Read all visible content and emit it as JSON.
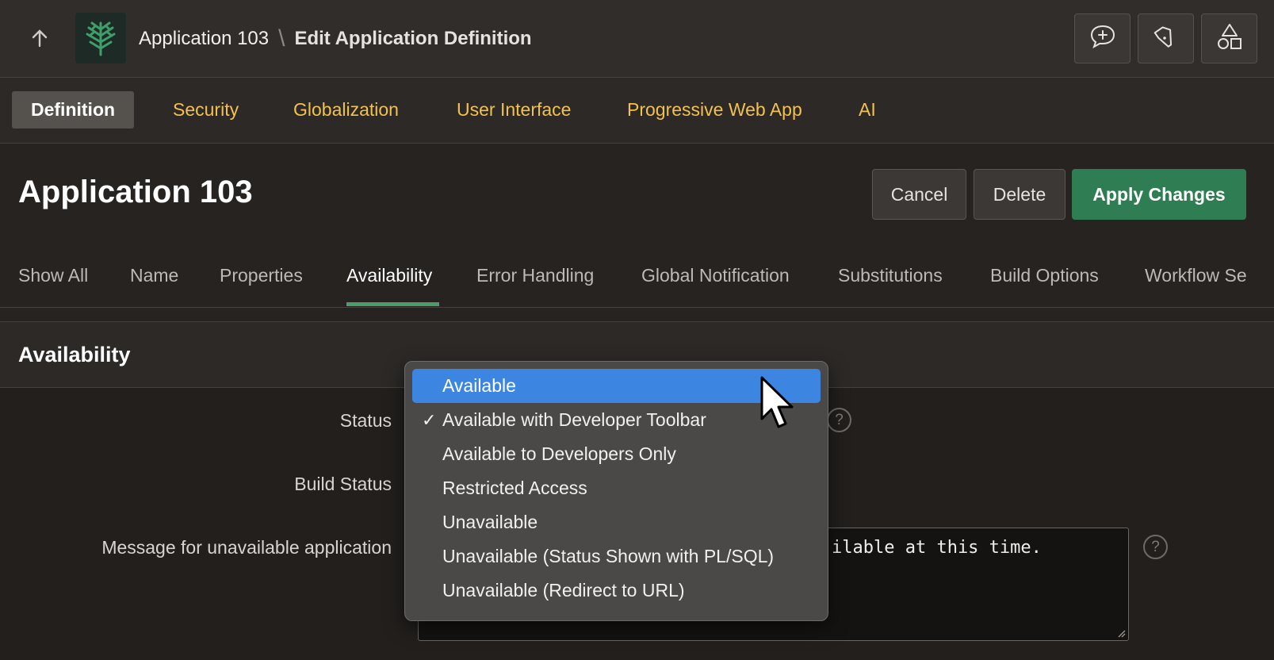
{
  "header": {
    "breadcrumb_app": "Application 103",
    "breadcrumb_separator": "\\",
    "breadcrumb_current": "Edit Application Definition",
    "icons": [
      "up-arrow-icon",
      "app-logo-icon",
      "feedback-icon",
      "flashlight-icon",
      "shapes-icon"
    ]
  },
  "tabs": [
    {
      "label": "Definition",
      "active": true
    },
    {
      "label": "Security"
    },
    {
      "label": "Globalization"
    },
    {
      "label": "User Interface"
    },
    {
      "label": "Progressive Web App"
    },
    {
      "label": "AI"
    }
  ],
  "page": {
    "title": "Application 103",
    "cancel_label": "Cancel",
    "delete_label": "Delete",
    "apply_label": "Apply Changes"
  },
  "sections": [
    {
      "label": "Show All"
    },
    {
      "label": "Name"
    },
    {
      "label": "Properties"
    },
    {
      "label": "Availability",
      "active": true
    },
    {
      "label": "Error Handling"
    },
    {
      "label": "Global Notification"
    },
    {
      "label": "Substitutions"
    },
    {
      "label": "Build Options"
    },
    {
      "label": "Workflow Se"
    }
  ],
  "region": {
    "title": "Availability",
    "status_label": "Status",
    "build_status_label": "Build Status",
    "message_label": "Message for unavailable application",
    "message_value_visible": "ilable at this time.",
    "help_symbol": "?"
  },
  "status_menu": {
    "options": [
      {
        "label": "Available",
        "highlighted": true
      },
      {
        "label": "Available with Developer Toolbar",
        "checked": true
      },
      {
        "label": "Available to Developers Only"
      },
      {
        "label": "Restricted Access"
      },
      {
        "label": "Unavailable"
      },
      {
        "label": "Unavailable (Status Shown with PL/SQL)"
      },
      {
        "label": "Unavailable (Redirect to URL)"
      }
    ],
    "check_mark": "✓"
  },
  "colors": {
    "accent_tab": "#f2c14e",
    "primary_button": "#2f7d52",
    "menu_highlight": "#3c86e2",
    "section_underline": "#4e9b6e"
  }
}
